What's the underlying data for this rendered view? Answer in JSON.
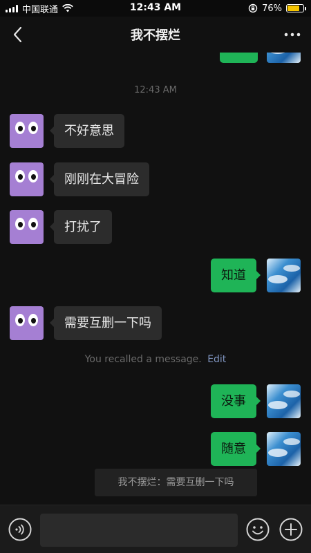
{
  "status_bar": {
    "carrier": "中国联通",
    "time": "12:43 AM",
    "battery_percent": "76%",
    "battery_level": 0.76,
    "icons": [
      "signal-icon",
      "wifi-icon",
      "rotation-lock-icon",
      "battery-icon"
    ]
  },
  "nav": {
    "title": "我不摆烂",
    "back_icon": "chevron-left-icon",
    "more_icon": "more-dots-icon"
  },
  "chat": {
    "timestamp": "12:43 AM",
    "messages": [
      {
        "side": "left",
        "text": "不好意思"
      },
      {
        "side": "left",
        "text": "刚刚在大冒险"
      },
      {
        "side": "left",
        "text": "打扰了"
      },
      {
        "side": "right",
        "text": "知道"
      },
      {
        "side": "left",
        "text": "需要互删一下吗"
      },
      {
        "side": "right",
        "text": "没事"
      },
      {
        "side": "right",
        "text": "随意"
      }
    ],
    "recall_notice": "You recalled a message.",
    "recall_edit": "Edit",
    "quote": "我不摆烂：需要互删一下吗"
  },
  "input_bar": {
    "voice_icon": "voice-icon",
    "emoji_icon": "emoji-icon",
    "plus_icon": "plus-icon",
    "placeholder": ""
  },
  "colors": {
    "background": "#111111",
    "incoming_bubble": "#2c2c2c",
    "outgoing_bubble": "#1fb457",
    "avatar": "#a57fd3",
    "battery": "#f7c600"
  }
}
